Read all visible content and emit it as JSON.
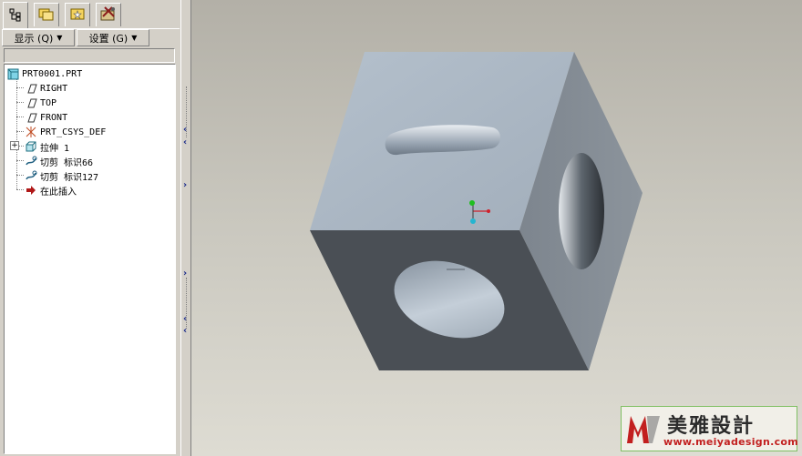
{
  "navigator": {
    "tabs": [
      {
        "icon": "model-tree-icon",
        "active": true
      },
      {
        "icon": "folder-browser-icon",
        "active": false
      },
      {
        "icon": "favorites-icon",
        "active": false
      },
      {
        "icon": "connections-icon",
        "active": false
      }
    ],
    "show_button": "显示 (Q)",
    "settings_button": "设置 (G)",
    "model_tree": [
      {
        "label": "PRT0001.PRT",
        "icon": "part-icon"
      },
      {
        "label": "RIGHT",
        "icon": "datum-plane-icon"
      },
      {
        "label": "TOP",
        "icon": "datum-plane-icon"
      },
      {
        "label": "FRONT",
        "icon": "datum-plane-icon"
      },
      {
        "label": "PRT_CSYS_DEF",
        "icon": "coordinate-system-icon"
      },
      {
        "label": "拉伸 1",
        "icon": "extrude-icon"
      },
      {
        "label": "切剪 标识66",
        "icon": "cut-icon"
      },
      {
        "label": "切剪 标识127",
        "icon": "cut-icon"
      },
      {
        "label": "在此插入",
        "icon": "insert-here-arrow-icon"
      }
    ]
  },
  "viewport": {
    "background_top": "#b3b0a7",
    "background_bottom": "#dedcd3",
    "model": {
      "top_face_color": "#aab6c3",
      "right_face_color": "#808891",
      "front_face_color": "#4a4f55",
      "csys_colors": [
        "#1fbf1f",
        "#d0202a",
        "#24b5d0"
      ]
    }
  },
  "watermark": {
    "title": "美雅設計",
    "url": "www.meiyadesign.com"
  }
}
